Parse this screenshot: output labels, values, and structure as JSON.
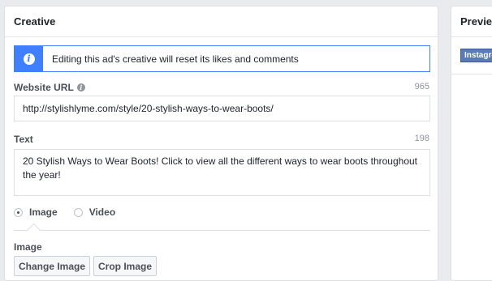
{
  "creative": {
    "title": "Creative",
    "notice": "Editing this ad's creative will reset its likes and comments",
    "website_url": {
      "label": "Website URL",
      "count": "965",
      "value": "http://stylishlyme.com/style/20-stylish-ways-to-wear-boots/"
    },
    "text": {
      "label": "Text",
      "count": "198",
      "value": "20 Stylish Ways to Wear Boots! Click to view all the different ways to wear boots throughout the year!"
    },
    "media_type": {
      "options": [
        "Image",
        "Video"
      ],
      "selected": "Image"
    },
    "image": {
      "label": "Image",
      "change_button": "Change Image",
      "crop_button": "Crop Image"
    }
  },
  "preview": {
    "title": "Preview",
    "tab": "Instagram"
  },
  "colors": {
    "accent": "#4080ff",
    "background": "#e9ebee",
    "tab": "#5b7bb5"
  }
}
